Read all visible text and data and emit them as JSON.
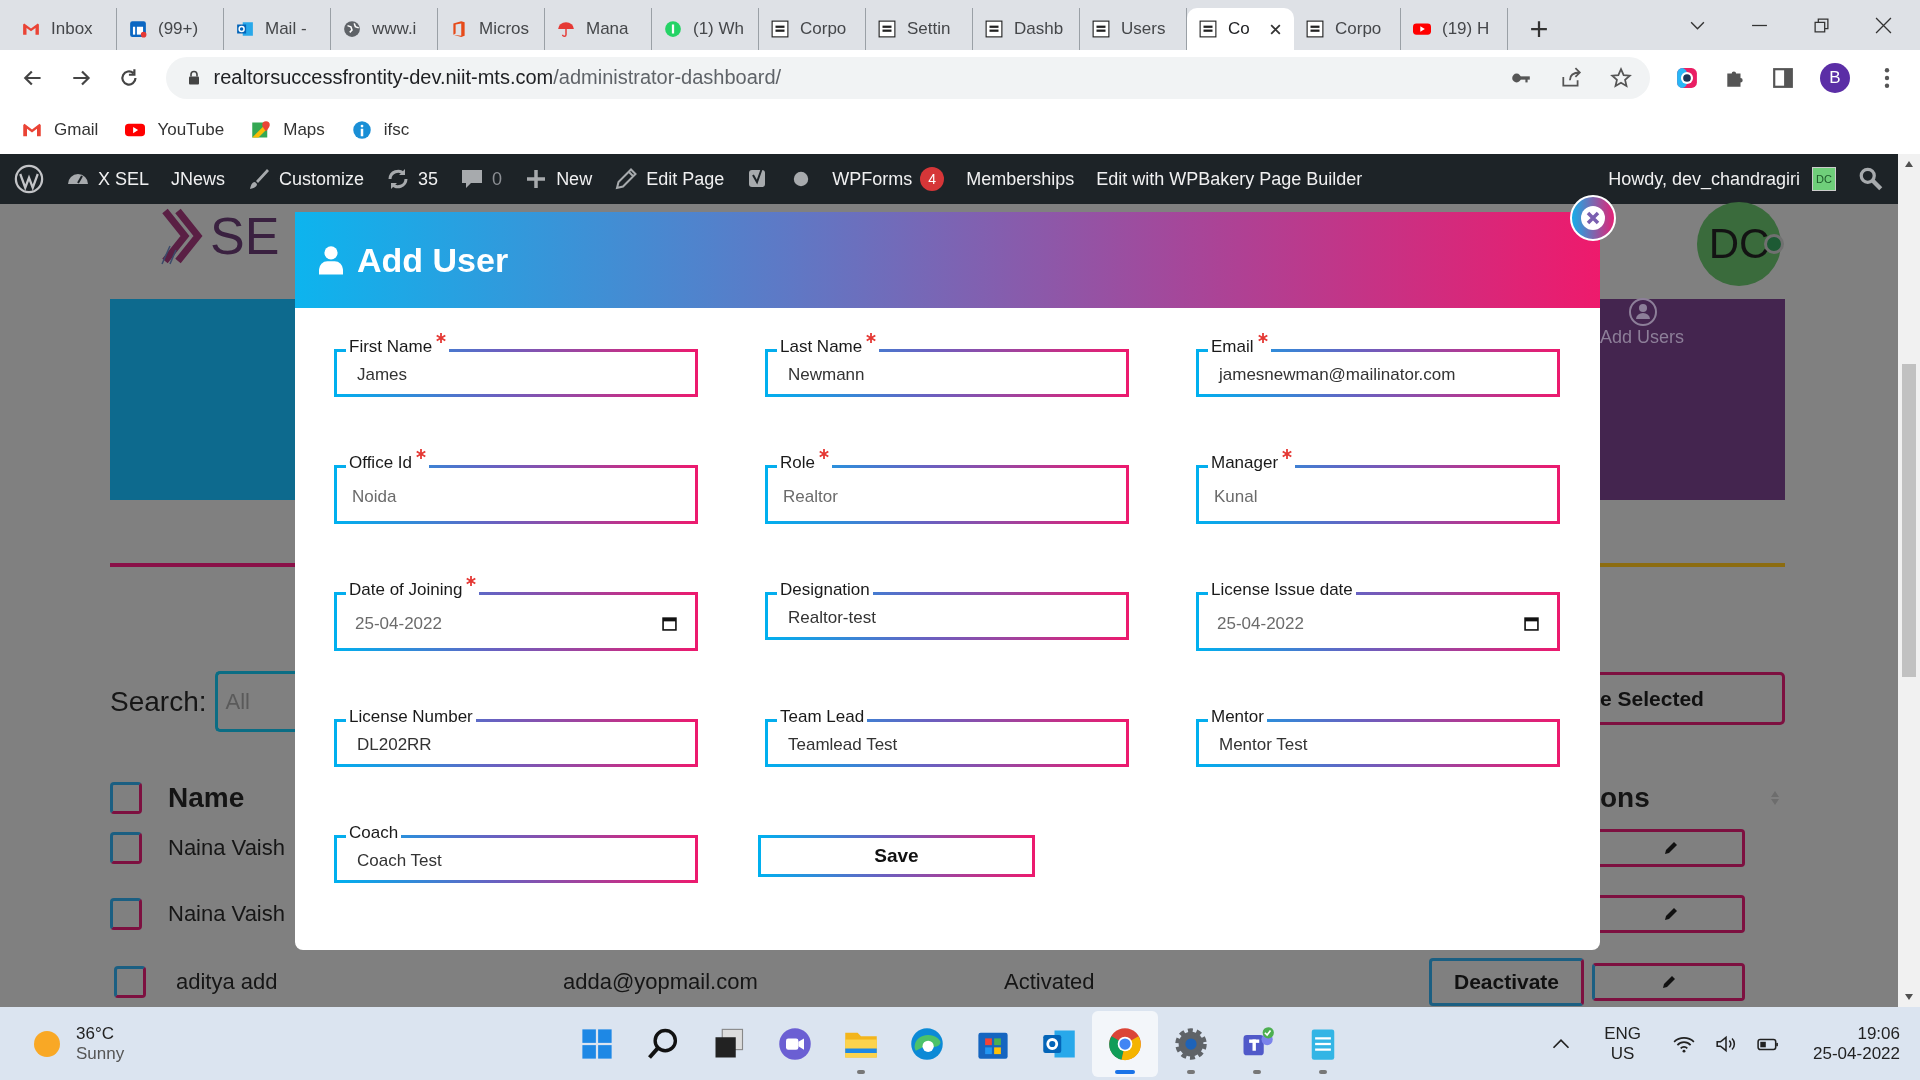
{
  "browser": {
    "tabs": [
      {
        "title": "Inbox",
        "kind": "gmail",
        "selected": false
      },
      {
        "title": "(99+)",
        "kind": "linkedin",
        "selected": false
      },
      {
        "title": "Mail -",
        "kind": "outlook",
        "selected": false
      },
      {
        "title": "www.i",
        "kind": "globe",
        "selected": false
      },
      {
        "title": "Micros",
        "kind": "office",
        "selected": false
      },
      {
        "title": "Mana",
        "kind": "umbrella",
        "selected": false
      },
      {
        "title": "(1) Wh",
        "kind": "whatsapp",
        "selected": false
      },
      {
        "title": "Corpo",
        "kind": "josh",
        "selected": false
      },
      {
        "title": "Settin",
        "kind": "josh",
        "selected": false
      },
      {
        "title": "Dashb",
        "kind": "josh",
        "selected": false
      },
      {
        "title": "Users",
        "kind": "josh",
        "selected": false
      },
      {
        "title": "Co",
        "kind": "josh",
        "selected": true
      },
      {
        "title": "Corpo",
        "kind": "josh",
        "selected": false
      },
      {
        "title": "(19) H",
        "kind": "youtube",
        "selected": false
      }
    ],
    "url_host": "realtorsuccessfrontity-dev.niit-mts.com",
    "url_path": "/administrator-dashboard/",
    "profile": "B",
    "bookmarks": [
      {
        "label": "Gmail",
        "kind": "gmail"
      },
      {
        "label": "YouTube",
        "kind": "youtube"
      },
      {
        "label": "Maps",
        "kind": "maps"
      },
      {
        "label": "ifsc",
        "kind": "info"
      }
    ]
  },
  "admin_bar": {
    "items": [
      {
        "kind": "wp"
      },
      {
        "kind": "dashboard",
        "label": "X SEL"
      },
      {
        "kind": "text",
        "label": "JNews"
      },
      {
        "kind": "brush",
        "label": "Customize"
      },
      {
        "kind": "updates",
        "label": "35"
      },
      {
        "kind": "comments",
        "label": "0"
      },
      {
        "kind": "plus",
        "label": "New"
      },
      {
        "kind": "pencil",
        "label": "Edit Page"
      },
      {
        "kind": "yoast"
      },
      {
        "kind": "dot"
      },
      {
        "kind": "forms",
        "label": "WPForms",
        "badge": "4"
      },
      {
        "kind": "text",
        "label": "Memberships"
      },
      {
        "kind": "text",
        "label": "Edit with WPBakery Page Builder"
      }
    ],
    "greeting": "Howdy, dev_chandragiri",
    "avatar": "DC"
  },
  "page": {
    "logo_text": "SE",
    "avatar": "DC",
    "add_users": "Add Users",
    "search_label": "Search:",
    "search_placeholder": "All",
    "bulk_button": "e Selected",
    "header": {
      "name": "Name",
      "actions": "ons",
      "checked": false
    },
    "rows": [
      {
        "name": "Naina Vaish",
        "checked": false
      },
      {
        "name": "Naina Vaish",
        "checked": false
      },
      {
        "name": "aditya add",
        "email": "adda@yopmail.com",
        "status": "Activated",
        "action": "Deactivate",
        "checked": false
      }
    ]
  },
  "modal": {
    "title": "Add User",
    "save": "Save",
    "fields": [
      {
        "label": "First Name",
        "required": true,
        "kind": "text",
        "value": "James"
      },
      {
        "label": "Last Name",
        "required": true,
        "kind": "text",
        "value": "Newmann"
      },
      {
        "label": "Email",
        "required": true,
        "kind": "text",
        "value": "jamesnewman@mailinator.com"
      },
      {
        "label": "Office Id",
        "required": true,
        "kind": "select",
        "value": "Noida"
      },
      {
        "label": "Role",
        "required": true,
        "kind": "select",
        "value": "Realtor"
      },
      {
        "label": "Manager",
        "required": true,
        "kind": "select",
        "value": "Kunal"
      },
      {
        "label": "Date of Joining",
        "required": true,
        "kind": "date",
        "value": "25-04-2022"
      },
      {
        "label": "Designation",
        "required": false,
        "kind": "text",
        "value": "Realtor-test"
      },
      {
        "label": "License Issue date",
        "required": false,
        "kind": "date",
        "value": "25-04-2022"
      },
      {
        "label": "License Number",
        "required": false,
        "kind": "text",
        "value": "DL202RR"
      },
      {
        "label": "Team Lead",
        "required": false,
        "kind": "text",
        "value": "Teamlead Test"
      },
      {
        "label": "Mentor",
        "required": false,
        "kind": "text",
        "value": "Mentor Test"
      },
      {
        "label": "Coach",
        "required": false,
        "kind": "text",
        "value": "Coach Test"
      }
    ]
  },
  "taskbar": {
    "temperature": "36°C",
    "weather": "Sunny",
    "apps": [
      {
        "kind": "start",
        "running": false,
        "selected": false
      },
      {
        "kind": "search",
        "running": false,
        "selected": false
      },
      {
        "kind": "taskview",
        "running": false,
        "selected": false
      },
      {
        "kind": "chat",
        "running": false,
        "selected": false
      },
      {
        "kind": "folder",
        "running": true,
        "selected": false
      },
      {
        "kind": "edge",
        "running": false,
        "selected": false
      },
      {
        "kind": "store",
        "running": false,
        "selected": false
      },
      {
        "kind": "outlook",
        "running": false,
        "selected": false
      },
      {
        "kind": "chrome",
        "running": true,
        "selected": true
      },
      {
        "kind": "settings",
        "running": true,
        "selected": false
      },
      {
        "kind": "teams",
        "running": true,
        "selected": false
      },
      {
        "kind": "notepad",
        "running": true,
        "selected": false
      }
    ],
    "lang": "ENG",
    "region": "US",
    "time": "19:06",
    "date": "25-04-2022"
  }
}
